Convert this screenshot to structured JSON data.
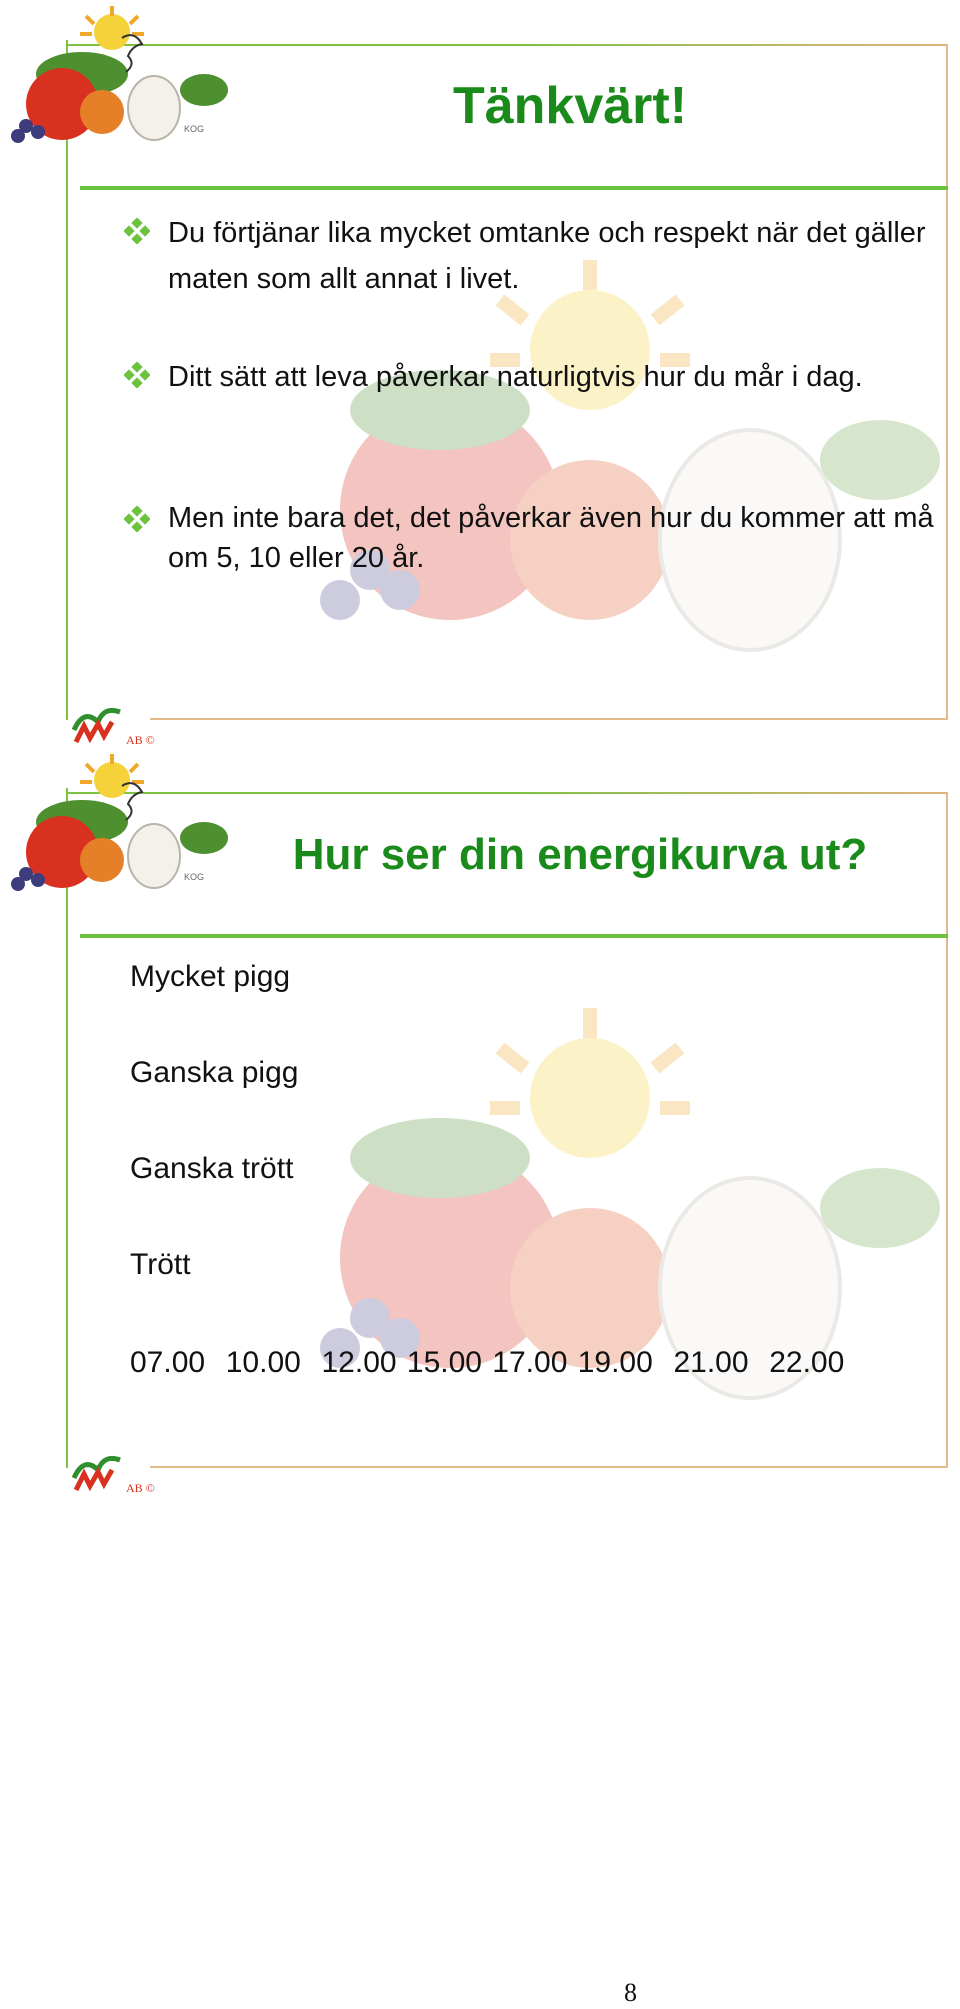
{
  "slides": [
    {
      "title": "Tänkvärt!",
      "bullets": [
        {
          "text": "Du förtjänar lika mycket omtanke och respekt när det gäller maten som allt annat i livet."
        },
        {
          "text": "Ditt sätt att leva påverkar naturligtvis hur du mår i dag."
        },
        {
          "text": "Men inte bara det, det påverkar även hur du kommer att må om 5, 10 eller 20 år."
        }
      ],
      "brand_logo_text": "AB ©"
    },
    {
      "title": "Hur ser din energikurva ut?",
      "scale_labels": [
        "Mycket pigg",
        "Ganska pigg",
        "Ganska trött",
        "Trött"
      ],
      "time_row": "07.00  10.00  12.00 15.00 17.00 19.00  21.00  22.00",
      "brand_logo_text": "AB ©"
    }
  ],
  "page_number": "8",
  "colors": {
    "title_green": "#1a8a1a",
    "rule_green": "#6cc23f",
    "frame_tan": "#e6b98a",
    "bullet_green": "#6cc23f"
  },
  "icons": [
    "fruit-vegetable-logo-icon",
    "diamond-bullet-icon",
    "company-logo-icon"
  ]
}
